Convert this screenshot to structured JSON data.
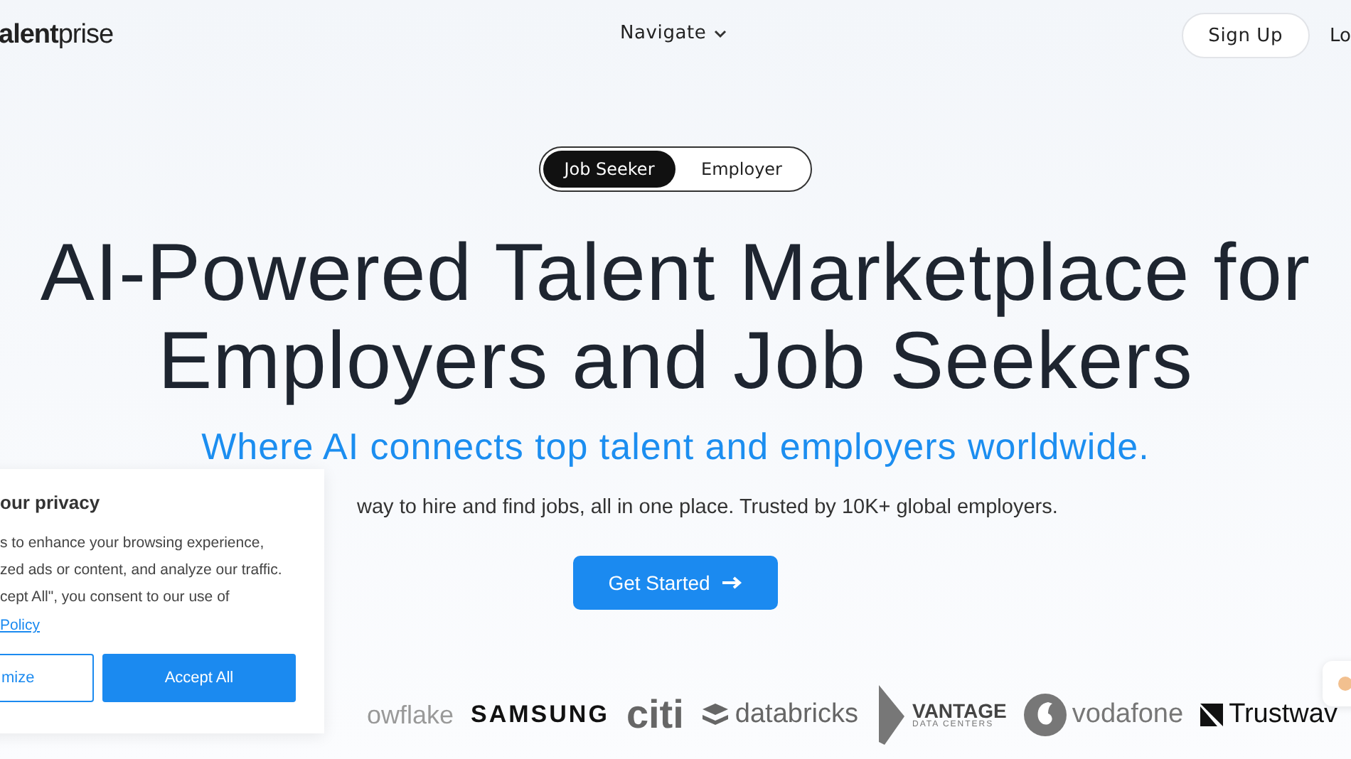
{
  "header": {
    "logo": "**alent**prise",
    "nav": "Navigate",
    "signup": "Sign Up",
    "login": "Lo"
  },
  "toggle": [
    {
      "label": "Job Seeker",
      "selected": true
    },
    {
      "label": "Employer",
      "selected": false
    }
  ],
  "hero": {
    "title_lines": [
      "AI-Powered Talent Marketplace for",
      "Employers and Job Seekers"
    ],
    "subtitle": "Where AI connects top talent and employers worldwide.",
    "description": "way to hire and find jobs, all in one place. Trusted by 10K+ global employers.",
    "cta": "Get Started"
  },
  "logos": [
    {
      "kind": "snowflake",
      "text": "owflake"
    },
    {
      "kind": "samsung",
      "text": "SAMSUNG"
    },
    {
      "kind": "citi",
      "text": "citi"
    },
    {
      "kind": "databricks",
      "text": "databricks"
    },
    {
      "kind": "vantage",
      "text": "VANTAGE",
      "sub": "DATA CENTERS"
    },
    {
      "kind": "vodafone",
      "text": "vodafone"
    },
    {
      "kind": "trustwave",
      "text": "Trustwav"
    }
  ],
  "cookie": {
    "title": "our privacy",
    "body": "s to enhance your browsing experience,\nzed ads or content, and analyze our traffic.\ncept All\", you consent to our use of",
    "link": "Policy",
    "buttons": [
      {
        "kind": "outline",
        "label": "mize"
      },
      {
        "kind": "primary",
        "label": "Accept All"
      }
    ]
  }
}
